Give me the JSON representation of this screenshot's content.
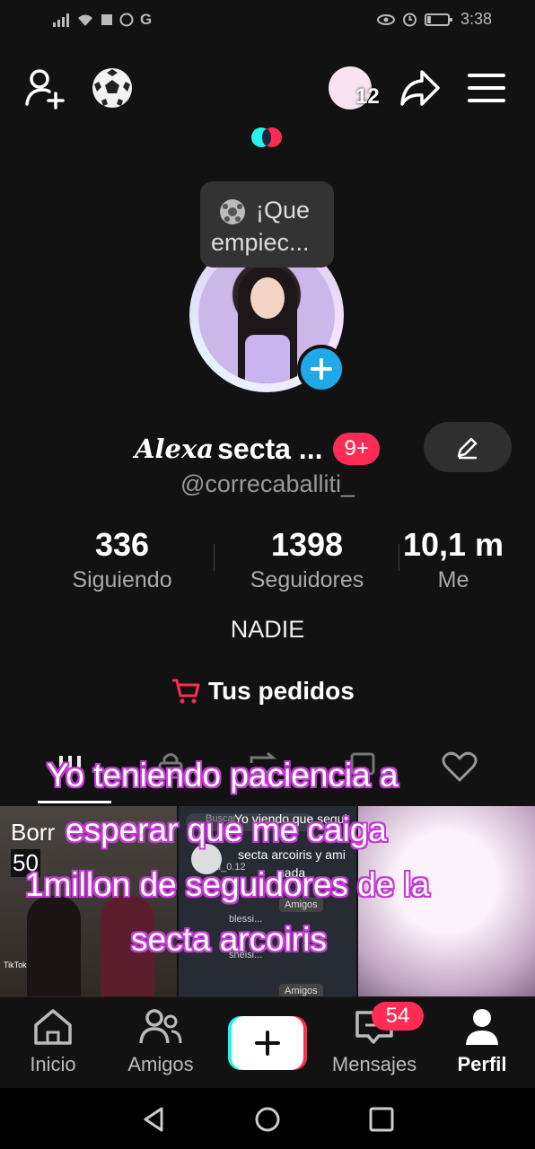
{
  "status_bar": {
    "time": "3:38"
  },
  "top_bar": {
    "badge_count": "12"
  },
  "tooltip": {
    "text": "¡Que empiec..."
  },
  "profile": {
    "name_script": "Alexa",
    "name_rest": "secta ...",
    "name_badge": "9+",
    "username": "@correcaballiti_",
    "bio": "NADIE",
    "orders_label": "Tus pedidos"
  },
  "stats": [
    {
      "value": "336",
      "label": "Siguiendo"
    },
    {
      "value": "1398",
      "label": "Seguidores"
    },
    {
      "value": "10,1 m",
      "label": "Me"
    }
  ],
  "overlay_caption": [
    "Yo teniendo paciencia a",
    "esperar que me caiga",
    "1millon de seguidores de la",
    "secta arcoiris"
  ],
  "thumbnails": [
    {
      "title": "Borr",
      "count": "50",
      "watermark": "TikTok"
    },
    {
      "search_placeholder": "Buscar",
      "lines": [
        "Yo viendo que segui",
        "secta arcoiris y ami",
        "nada"
      ],
      "user1": "ailu_0.12",
      "user2": "blessi...",
      "user3": "sheisi...",
      "tag": "Amigos"
    }
  ],
  "bottom_nav": [
    {
      "label": "Inicio",
      "icon": "home-icon"
    },
    {
      "label": "Amigos",
      "icon": "friends-icon"
    },
    {
      "label": "",
      "icon": "create-plus-icon"
    },
    {
      "label": "Mensajes",
      "icon": "messages-icon",
      "badge": "54"
    },
    {
      "label": "Perfil",
      "icon": "profile-icon"
    }
  ],
  "colors": {
    "background": "#121212",
    "badge_red": "#fe2c55",
    "add_blue": "#20a8e8",
    "caption_outline": "#c43ad4"
  }
}
